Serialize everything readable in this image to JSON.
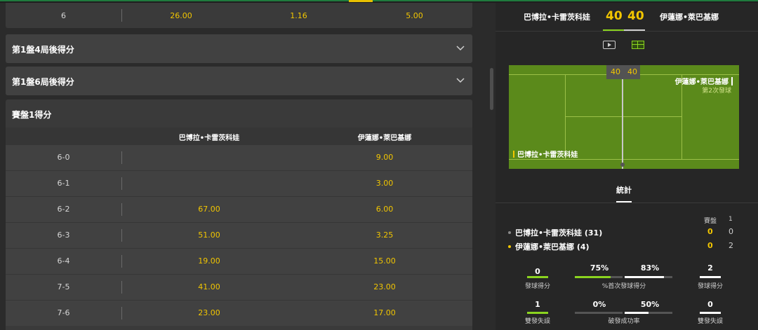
{
  "colors": {
    "accent": "#f2c600",
    "green": "#8bd41f",
    "court": "#5b8a1b"
  },
  "top_row": {
    "label": "6",
    "v1": "26.00",
    "v2": "1.16",
    "v3": "5.00"
  },
  "accordions": [
    {
      "title": "第1盤4局後得分",
      "icon": "chevron-down-icon"
    },
    {
      "title": "第1盤6局後得分",
      "icon": "chevron-down-icon"
    }
  ],
  "matrix": {
    "title": "賽盤1得分",
    "col1": "巴博拉•卡雷茨科娃",
    "col2": "伊蓮娜•萊巴基娜",
    "rows": [
      {
        "score": "6-0",
        "v1": "",
        "v2": "9.00"
      },
      {
        "score": "6-1",
        "v1": "",
        "v2": "3.00"
      },
      {
        "score": "6-2",
        "v1": "67.00",
        "v2": "6.00"
      },
      {
        "score": "6-3",
        "v1": "51.00",
        "v2": "3.25"
      },
      {
        "score": "6-4",
        "v1": "19.00",
        "v2": "15.00"
      },
      {
        "score": "7-5",
        "v1": "41.00",
        "v2": "23.00"
      },
      {
        "score": "7-6",
        "v1": "23.00",
        "v2": "17.00"
      }
    ]
  },
  "scoreboard": {
    "player1": "巴博拉•卡雷茨科娃",
    "player2": "伊蓮娜•萊巴基娜",
    "score1": "40",
    "score2": "40"
  },
  "court": {
    "score1": "40",
    "score2": "40",
    "server": "伊蓮娜•萊巴基娜",
    "serve_note": "第2次發球",
    "receiver": "巴博拉•卡雷茨科娃"
  },
  "stats_tab": "統計",
  "set_header": {
    "label": "賽盤",
    "set1": "1"
  },
  "players": [
    {
      "name": "巴博拉•卡雷茨科娃 (31)",
      "dot": "#888888",
      "points": "0",
      "set1": "0"
    },
    {
      "name": "伊蓮娜•萊巴基娜 (4)",
      "dot": "#f2c600",
      "points": "0",
      "set1": "2"
    }
  ],
  "stats": {
    "aces_p1": "0",
    "aces_label": "發球得分",
    "aces_p2": "2",
    "first_serve_p1": "75%",
    "first_serve_p2": "83%",
    "first_serve_label": "%首次發球得分",
    "df_p1": "1",
    "df_label": "雙發失誤",
    "df_p2": "0",
    "bp_p1": "0%",
    "bp_p2": "50%",
    "bp_label": "破發成功率"
  }
}
